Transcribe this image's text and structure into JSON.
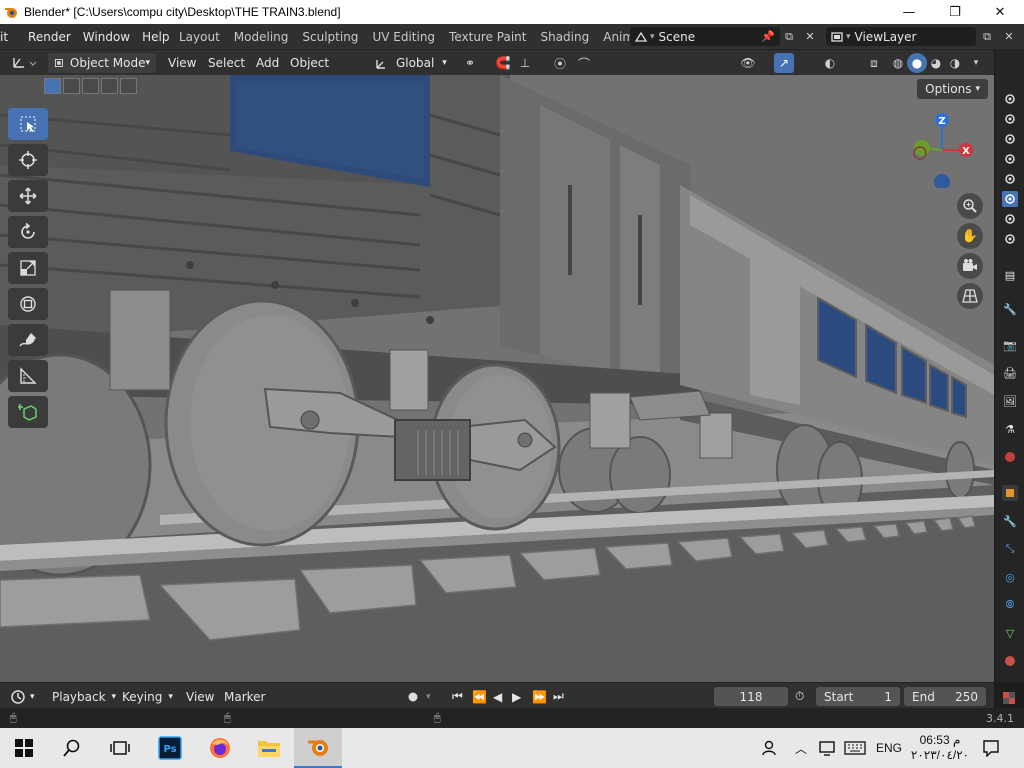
{
  "window": {
    "title": "Blender* [C:\\Users\\compu city\\Desktop\\THE TRAIN3.blend]",
    "minimize": "—",
    "maximize": "❐",
    "close": "✕"
  },
  "menubar": {
    "items": [
      {
        "label": "it"
      },
      {
        "label": "Render"
      },
      {
        "label": "Window"
      },
      {
        "label": "Help"
      }
    ]
  },
  "workspaces": {
    "tabs": [
      {
        "label": "Layout"
      },
      {
        "label": "Modeling"
      },
      {
        "label": "Sculpting"
      },
      {
        "label": "UV Editing"
      },
      {
        "label": "Texture Paint"
      },
      {
        "label": "Shading"
      },
      {
        "label": "Animati"
      }
    ]
  },
  "scene": {
    "name": "Scene"
  },
  "view_layer": {
    "name": "ViewLayer"
  },
  "header": {
    "mode": "Object Mode",
    "menus": [
      {
        "label": "View"
      },
      {
        "label": "Select"
      },
      {
        "label": "Add"
      },
      {
        "label": "Object"
      }
    ],
    "orientation": "Global"
  },
  "viewport": {
    "options_label": "Options",
    "gizmo": {
      "z": "Z",
      "x": "X",
      "z_color": "#2f6fd6",
      "x_color": "#d0343d",
      "y_color": "#6a9e2a"
    }
  },
  "timeline": {
    "editor_icon": "clock-icon",
    "menus": [
      {
        "label": "Playback"
      },
      {
        "label": "Keying"
      },
      {
        "label": "View"
      },
      {
        "label": "Marker"
      }
    ],
    "current_frame": "118",
    "start_label": "Start",
    "start_value": "1",
    "end_label": "End",
    "end_value": "250"
  },
  "statusbar": {
    "version": "3.4.1"
  },
  "taskbar": {
    "language": "ENG",
    "time": "06:53 م",
    "date": "٢٠٢٣/٠٤/٢٠"
  },
  "colors": {
    "accent": "#4772b3",
    "header_bg": "#303030",
    "viewport_bg": "#6a6a6a",
    "window_glass": "#2d4a7a"
  }
}
